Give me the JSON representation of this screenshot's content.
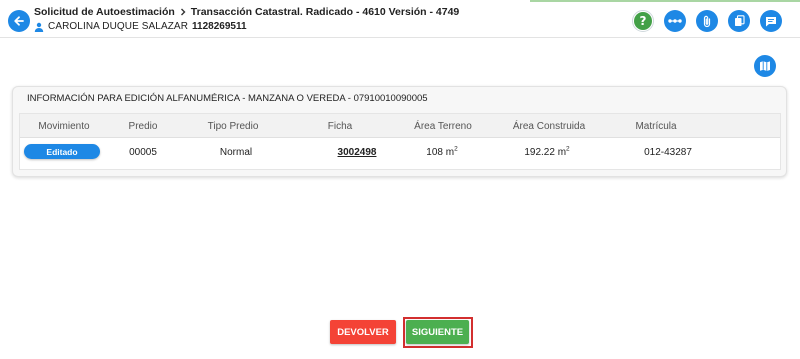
{
  "header": {
    "crumb_root": "Solicitud de Autoestimación",
    "crumb_current": "Transacción Catastral. Radicado - 4610 Versión - 4749",
    "user_name": "CAROLINA DUQUE SALAZAR",
    "user_id": "1128269511",
    "help_glyph": "?"
  },
  "panel": {
    "title": "INFORMACIÓN PARA EDICIÓN ALFANUMÉRICA - MANZANA O VEREDA - 07910010090005",
    "columns": [
      "Movimiento",
      "Predio",
      "Tipo Predio",
      "Ficha",
      "Área Terreno",
      "Área Construida",
      "Matrícula"
    ],
    "row": {
      "movimiento": "Editado",
      "predio": "00005",
      "tipo_predio": "Normal",
      "ficha": "3002498",
      "area_terreno": "108 m",
      "area_terreno_sup": "2",
      "area_construida": "192.22 m",
      "area_construida_sup": "2",
      "matricula": "012-43287"
    }
  },
  "buttons": {
    "devolver": "DEVOLVER",
    "siguiente": "SIGUIENTE"
  },
  "colors": {
    "primary": "#1e88e5",
    "danger": "#f44336",
    "success": "#4caf50",
    "highlight": "#d32f2f"
  },
  "icons": [
    "back-arrow-icon",
    "chevron-right-icon",
    "person-icon",
    "help-icon",
    "more-horizontal-icon",
    "paperclip-icon",
    "copy-icon",
    "message-icon",
    "map-icon"
  ]
}
